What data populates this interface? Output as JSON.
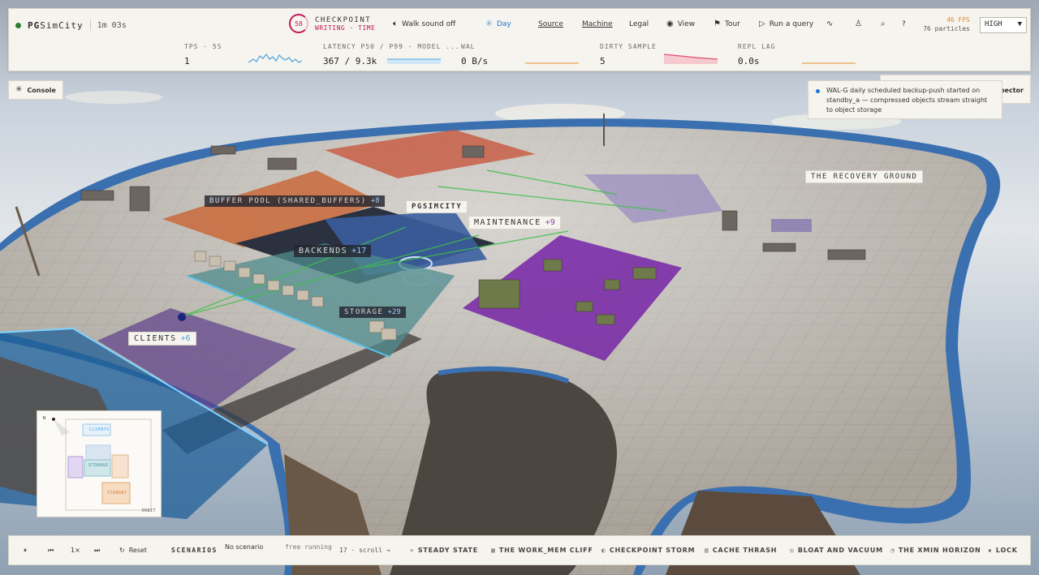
{
  "app": {
    "brand_prefix": "PG",
    "brand_suffix": "SimCity",
    "uptime": "1m 03s"
  },
  "checkpoint": {
    "ring_value": "58",
    "title": "CHECKPOINT",
    "status": "WRITING · TIME",
    "color": "#c2185b"
  },
  "nav": {
    "walk_sound": "Walk sound off",
    "day": "Day",
    "source": "Source",
    "machine": "Machine",
    "legal": "Legal",
    "view": "View",
    "tour": "Tour",
    "run_query": "Run a query",
    "help": "?"
  },
  "perf": {
    "fps": "46 FPS",
    "particles": "76 particles",
    "quality": "HIGH"
  },
  "metrics": [
    {
      "label": "TPS · 5S",
      "value": "1"
    },
    {
      "label": "LATENCY P50 / P99 · MODEL ...",
      "value": "367 / 9.3k"
    },
    {
      "label": "WAL",
      "value": "0 B/s"
    },
    {
      "label": "DIRTY SAMPLE",
      "value": "5"
    },
    {
      "label": "REPL LAG",
      "value": "0.0s"
    }
  ],
  "console": {
    "label": "Console"
  },
  "inspector": {
    "label": "pector"
  },
  "toast": {
    "text": "WAL-G daily scheduled backup-push started on standby_a — compressed objects stream straight to object storage"
  },
  "zones": {
    "recovery": "THE RECOVERY GROUND",
    "buffer_pool": {
      "name": "BUFFER POOL (SHARED_BUFFERS)",
      "count": "+8"
    },
    "pgsimcity": "PGSIMCITY",
    "maintenance": {
      "name": "MAINTENANCE",
      "count": "+9"
    },
    "backends": {
      "name": "BACKENDS",
      "count": "+17"
    },
    "storage": {
      "name": "STORAGE",
      "count": "+29"
    },
    "clients": {
      "name": "CLIENTS",
      "count": "+6"
    }
  },
  "minimap": {
    "n": "N",
    "clients": "CLIENTS",
    "storage": "STORAGE",
    "standby": "STANDBY",
    "orbit": "ORBIT"
  },
  "playback": {
    "pause": "⏸",
    "prev": "⏮",
    "speed": "1×",
    "next": "⏭",
    "reset": "Reset",
    "scenarios_label": "SCENARIOS",
    "no_scenario": "No scenario",
    "free_running": "free running",
    "count_scroll": "17 · scroll →"
  },
  "scenarios": [
    {
      "icon": "✳",
      "label": "STEADY STATE"
    },
    {
      "icon": "▦",
      "label": "THE WORK_MEM CLIFF"
    },
    {
      "icon": "◐",
      "label": "CHECKPOINT STORM"
    },
    {
      "icon": "▥",
      "label": "CACHE THRASH"
    },
    {
      "icon": "◎",
      "label": "BLOAT AND VACUUM"
    },
    {
      "icon": "◔",
      "label": "THE XMIN HORIZON"
    },
    {
      "icon": "▪",
      "label": "LOCK"
    }
  ],
  "colors": {
    "accent": "#1976d2",
    "fps": "#e6892a",
    "maintenance": "#7b2ea8",
    "buffer": "#c9693a",
    "clients": "#1f6fa8"
  }
}
